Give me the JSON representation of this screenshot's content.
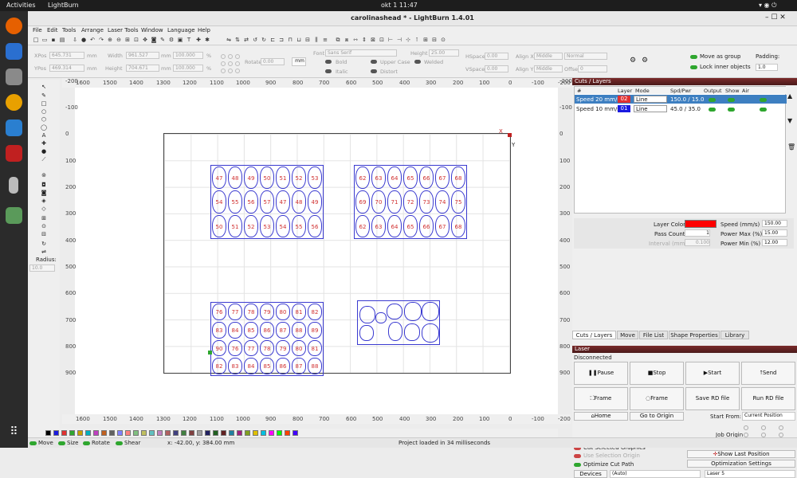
{
  "topbar": {
    "activities": "Activities",
    "app": "LightBurn",
    "clock": "okt 1  11:47"
  },
  "window": {
    "title": "carolinashead * - LightBurn 1.4.01"
  },
  "menu": [
    "File",
    "Edit",
    "Tools",
    "Arrange",
    "Laser Tools",
    "Window",
    "Language",
    "Help"
  ],
  "props": {
    "xpos_label": "XPos",
    "xpos": "645.731",
    "ypos_label": "YPos",
    "ypos": "469.314",
    "unit": "mm",
    "width_label": "Width",
    "width": "961.527",
    "height_label": "Height",
    "height": "704.671",
    "pct1": "100.000",
    "pct2": "100.000",
    "pct_unit": "%",
    "rotate_label": "Rotate",
    "rotate": "0.00",
    "mm_btn": "mm",
    "font_label": "Font",
    "font": "Sans Serif",
    "height2_label": "Height",
    "height2": "25.00",
    "hspace_label": "HSpace",
    "hspace": "0.00",
    "vspace_label": "VSpace",
    "vspace": "0.00",
    "alignx_label": "Align X",
    "alignx": "Middle",
    "aligny_label": "Align Y",
    "aligny": "Middle",
    "normal": "Normal",
    "offset_label": "Offset",
    "offset": "0",
    "bold": "Bold",
    "italic": "Italic",
    "upper": "Upper Case",
    "welded": "Welded",
    "distort": "Distort",
    "move_as_group": "Move as group",
    "lock_inner": "Lock inner objects",
    "padding_label": "Padding:",
    "padding": "1.0"
  },
  "lefttools": {
    "radius_label": "Radius:",
    "radius": "10.0"
  },
  "ruler": {
    "top": [
      "1600",
      "1500",
      "1400",
      "1300",
      "1200",
      "1100",
      "1000",
      "900",
      "800",
      "700",
      "600",
      "500",
      "400",
      "300",
      "200",
      "100",
      "0",
      "-100",
      "-200"
    ],
    "left": [
      "-200",
      "-100",
      "0",
      "100",
      "200",
      "300",
      "400",
      "500",
      "600",
      "700",
      "800",
      "900"
    ],
    "right": [
      "-200",
      "-100",
      "0",
      "100",
      "200",
      "300",
      "400",
      "500",
      "600",
      "700",
      "800",
      "900"
    ]
  },
  "canvas": {
    "x_marker": "X",
    "y_marker": "Y",
    "g1": [
      "47",
      "48",
      "49",
      "50",
      "51",
      "52",
      "53",
      "54",
      "55",
      "56",
      "57"
    ],
    "g2": [
      "62",
      "63",
      "64",
      "65",
      "66",
      "67",
      "68",
      "69",
      "70",
      "71",
      "72",
      "73",
      "74",
      "75"
    ],
    "g3": [
      "76",
      "77",
      "78",
      "79",
      "80",
      "81",
      "82",
      "83",
      "84",
      "85",
      "86",
      "87",
      "88",
      "89",
      "90"
    ]
  },
  "cuts": {
    "title": "Cuts / Layers",
    "cols": [
      "#",
      "Layer",
      "Mode",
      "Spd/Pwr",
      "Output",
      "Show",
      "Air"
    ],
    "rows": [
      {
        "name": "Speed 20 mm/s",
        "layer": "02",
        "mode": "Line",
        "sp": "150.0 / 15.0",
        "color": "#e03030"
      },
      {
        "name": "Speed 10 mm/s",
        "layer": "01",
        "mode": "Line",
        "sp": "45.0 / 35.0",
        "color": "#1a1ae0"
      }
    ],
    "layer_color_label": "Layer Color",
    "layer_color": "#ff0000",
    "speed_label": "Speed (mm/s)",
    "speed": "150.00",
    "pass_label": "Pass Count",
    "pass": "1",
    "pmax_label": "Power Max (%)",
    "pmax": "15.00",
    "interval_label": "Interval (mm)",
    "interval": "0.100",
    "pmin_label": "Power Min (%)",
    "pmin": "12.00"
  },
  "tabs": [
    "Cuts / Layers",
    "Move",
    "File List",
    "Shape Properties",
    "Library"
  ],
  "laser": {
    "title": "Laser",
    "status": "Disconnected",
    "pause": "Pause",
    "stop": "Stop",
    "start": "Start",
    "send": "Send",
    "frame1": "Frame",
    "frame2": "Frame",
    "save_rd": "Save RD file",
    "run_rd": "Run RD file",
    "home": "Home",
    "goto_origin": "Go to Origin",
    "start_from_label": "Start From:",
    "start_from": "Current Position",
    "job_origin": "Job Origin",
    "cut_selected": "Cut Selected Graphics",
    "use_selection": "Use Selection Origin",
    "show_last": "Show Last Position",
    "optimize": "Optimize Cut Path",
    "opt_settings": "Optimization Settings",
    "devices": "Devices",
    "auto": "(Auto)",
    "laser_name": "Laser 5"
  },
  "status": {
    "move": "Move",
    "size": "Size",
    "rotate": "Rotate",
    "shear": "Shear",
    "coords": "x: -42.00, y: 384.00 mm",
    "msg": "Project loaded in 34 milliseconds"
  },
  "palette": [
    "#000000",
    "#1a1ae0",
    "#e03030",
    "#2ea62e",
    "#c8a000",
    "#00b0c0",
    "#c040c0",
    "#c06020",
    "#606060",
    "#8080ff",
    "#ff8080",
    "#80c080",
    "#c0c060",
    "#60c0c0",
    "#c080c0",
    "#b06060",
    "#404080",
    "#408040",
    "#804040",
    "#a0a0a0",
    "#202060",
    "#206020",
    "#602020",
    "#2080a0",
    "#a02080",
    "#80a020",
    "#e0c000",
    "#00c0e0",
    "#ff00ff",
    "#00ff00",
    "#ff4000",
    "#4000ff"
  ]
}
